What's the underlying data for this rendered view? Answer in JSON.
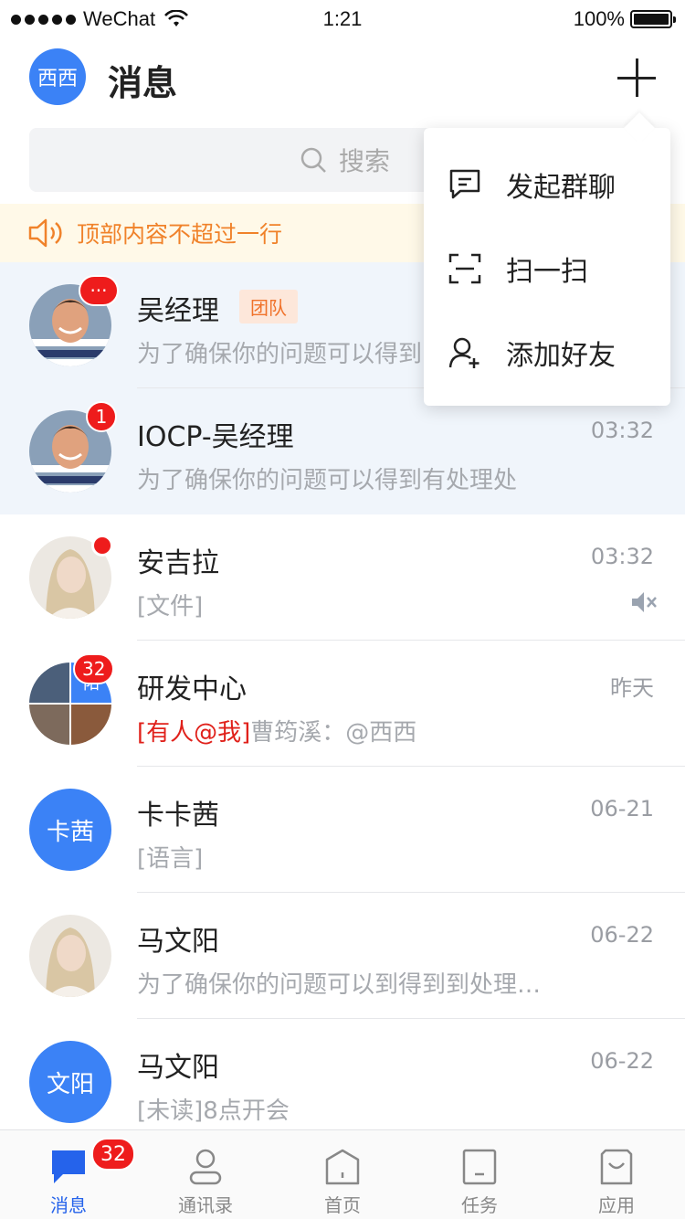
{
  "status_bar": {
    "carrier": "WeChat",
    "time": "1:21",
    "battery": "100%"
  },
  "header": {
    "me_avatar": "西西",
    "title": "消息"
  },
  "search": {
    "placeholder": "搜索"
  },
  "notice": {
    "text": "顶部内容不超过一行"
  },
  "menu": {
    "items": [
      {
        "label": "发起群聊",
        "icon": "chat-bubble-icon"
      },
      {
        "label": "扫一扫",
        "icon": "scan-icon"
      },
      {
        "label": "添加好友",
        "icon": "add-user-icon"
      }
    ]
  },
  "chats": [
    {
      "name": "吴经理",
      "tag": "团队",
      "time": "",
      "preview": "为了确保你的问题可以得到",
      "badge": "···",
      "avatar": "photo-man"
    },
    {
      "name": "IOCP-吴经理",
      "time": "03:32",
      "preview": "为了确保你的问题可以得到有处理处",
      "badge": "1",
      "avatar": "photo-man"
    },
    {
      "name": "安吉拉",
      "time": "03:32",
      "preview": "[文件]",
      "badge": "dot",
      "avatar": "photo-woman"
    },
    {
      "name": "研发中心",
      "time": "昨天",
      "mention": "[有人@我]",
      "preview": "曹筠溪：@西西",
      "badge": "32",
      "avatar": "group",
      "group_label": "阳"
    },
    {
      "name": "卡卡茜",
      "time": "06-21",
      "preview": "[语言]",
      "avatar_text": "卡茜"
    },
    {
      "name": "马文阳",
      "time": "06-22",
      "preview": "为了确保你的问题可以到得到到处理…",
      "avatar": "photo-woman"
    },
    {
      "name": "马文阳",
      "time": "06-22",
      "preview": "[未读]8点开会",
      "avatar_text": "文阳"
    }
  ],
  "tabs": [
    {
      "label": "消息",
      "icon": "message-icon",
      "badge": "32"
    },
    {
      "label": "通讯录",
      "icon": "contacts-icon"
    },
    {
      "label": "首页",
      "icon": "home-icon"
    },
    {
      "label": "任务",
      "icon": "task-icon"
    },
    {
      "label": "应用",
      "icon": "apps-icon"
    }
  ],
  "colors": {
    "accent": "#3b82f6",
    "badge": "#ee1c1c",
    "notice": "#f0822a"
  }
}
